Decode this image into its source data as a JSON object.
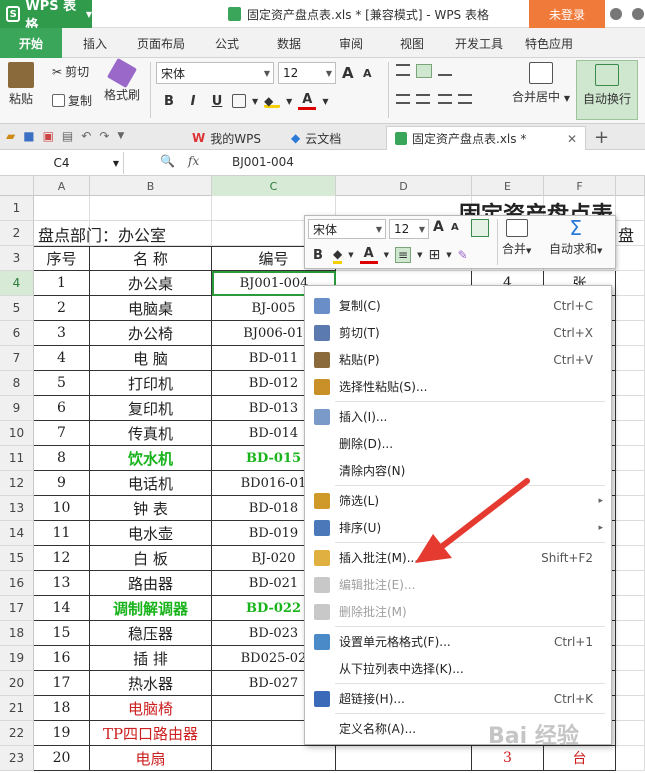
{
  "titlebar": {
    "app_name": "WPS 表格",
    "logo_letter": "S",
    "doc_title": "固定资产盘点表.xls * [兼容模式] - WPS 表格",
    "login": "未登录"
  },
  "menus": [
    "开始",
    "插入",
    "页面布局",
    "公式",
    "数据",
    "审阅",
    "视图",
    "开发工具",
    "特色应用"
  ],
  "ribbon": {
    "cut": "剪切",
    "copy": "复制",
    "paste": "粘贴",
    "format_painter": "格式刷",
    "font_name": "宋体",
    "font_size": "12",
    "bold": "B",
    "italic": "I",
    "underline": "U",
    "merge_center": "合并居中",
    "wrap_text": "自动换行",
    "grow_font": "A",
    "shrink_font": "A"
  },
  "tabs": [
    "我的WPS",
    "云文档",
    "固定资产盘点表.xls *"
  ],
  "formula": {
    "cell_ref": "C4",
    "fx": "fx",
    "content": "BJ001-004"
  },
  "columns": [
    "A",
    "B",
    "C",
    "D",
    "E",
    "F"
  ],
  "row_numbers": [
    "1",
    "2",
    "3",
    "4",
    "5",
    "6",
    "7",
    "8",
    "9",
    "10",
    "11",
    "12",
    "13",
    "14",
    "15",
    "16",
    "17",
    "18",
    "19",
    "20",
    "21",
    "22",
    "23"
  ],
  "sheet": {
    "title": "固定资产盘点表",
    "dept_label": "盘点部门：办公室",
    "right_cut": "盘",
    "headers": [
      "序号",
      "名 称",
      "编号"
    ],
    "rows": [
      {
        "a": "1",
        "b": "办公桌",
        "c": "BJ001-004",
        "e": "4",
        "f": "张",
        "style": ""
      },
      {
        "a": "2",
        "b": "电脑桌",
        "c": "BJ-005",
        "e": "",
        "f": "",
        "style": ""
      },
      {
        "a": "3",
        "b": "办公椅",
        "c": "BJ006-01",
        "e": "",
        "f": "",
        "style": ""
      },
      {
        "a": "4",
        "b": "电  脑",
        "c": "BD-011",
        "e": "",
        "f": "",
        "style": ""
      },
      {
        "a": "5",
        "b": "打印机",
        "c": "BD-012",
        "e": "",
        "f": "",
        "style": ""
      },
      {
        "a": "6",
        "b": "复印机",
        "c": "BD-013",
        "e": "",
        "f": "",
        "style": ""
      },
      {
        "a": "7",
        "b": "传真机",
        "c": "BD-014",
        "e": "",
        "f": "",
        "style": ""
      },
      {
        "a": "8",
        "b": "饮水机",
        "c": "BD-015",
        "e": "",
        "f": "",
        "style": "green"
      },
      {
        "a": "9",
        "b": "电话机",
        "c": "BD016-01",
        "e": "",
        "f": "",
        "style": ""
      },
      {
        "a": "10",
        "b": "钟  表",
        "c": "BD-018",
        "e": "",
        "f": "",
        "style": ""
      },
      {
        "a": "11",
        "b": "电水壶",
        "c": "BD-019",
        "e": "",
        "f": "",
        "style": ""
      },
      {
        "a": "12",
        "b": "白  板",
        "c": "BJ-020",
        "e": "",
        "f": "",
        "style": ""
      },
      {
        "a": "13",
        "b": "路由器",
        "c": "BD-021",
        "e": "",
        "f": "",
        "style": ""
      },
      {
        "a": "14",
        "b": "调制解调器",
        "c": "BD-022",
        "e": "",
        "f": "",
        "style": "green"
      },
      {
        "a": "15",
        "b": "稳压器",
        "c": "BD-023",
        "e": "",
        "f": "",
        "style": ""
      },
      {
        "a": "16",
        "b": "插  排",
        "c": "BD025-02",
        "e": "",
        "f": "",
        "style": ""
      },
      {
        "a": "17",
        "b": "热水器",
        "c": "BD-027",
        "e": "",
        "f": "",
        "style": ""
      },
      {
        "a": "18",
        "b": "电脑椅",
        "c": "",
        "e": "",
        "f": "",
        "style": "red"
      },
      {
        "a": "19",
        "b": "TP四口路由器",
        "c": "",
        "e": "",
        "f": "",
        "style": "red"
      },
      {
        "a": "20",
        "b": "电扇",
        "c": "",
        "e": "3",
        "f": "台",
        "style": "red"
      }
    ]
  },
  "minibar": {
    "font": "宋体",
    "size": "12",
    "merge": "合并",
    "autosum": "自动求和",
    "bold": "B"
  },
  "context_menu": [
    {
      "label": "复制(C)",
      "shortcut": "Ctrl+C",
      "icon": "copy-icon",
      "disabled": false,
      "sub": false
    },
    {
      "label": "剪切(T)",
      "shortcut": "Ctrl+X",
      "icon": "scissors-icon",
      "disabled": false,
      "sub": false
    },
    {
      "label": "粘贴(P)",
      "shortcut": "Ctrl+V",
      "icon": "paste-icon",
      "disabled": false,
      "sub": false
    },
    {
      "label": "选择性粘贴(S)...",
      "shortcut": "",
      "icon": "paste-special-icon",
      "disabled": false,
      "sub": false,
      "sep_after": true
    },
    {
      "label": "插入(I)...",
      "shortcut": "",
      "icon": "insert-icon",
      "disabled": false,
      "sub": false
    },
    {
      "label": "删除(D)...",
      "shortcut": "",
      "icon": "",
      "disabled": false,
      "sub": false
    },
    {
      "label": "清除内容(N)",
      "shortcut": "",
      "icon": "",
      "disabled": false,
      "sub": false,
      "sep_after": true
    },
    {
      "label": "筛选(L)",
      "shortcut": "",
      "icon": "filter-icon",
      "disabled": false,
      "sub": true
    },
    {
      "label": "排序(U)",
      "shortcut": "",
      "icon": "sort-icon",
      "disabled": false,
      "sub": true,
      "sep_after": true
    },
    {
      "label": "插入批注(M)...",
      "shortcut": "Shift+F2",
      "icon": "comment-insert-icon",
      "disabled": false,
      "sub": false
    },
    {
      "label": "编辑批注(E)...",
      "shortcut": "",
      "icon": "comment-edit-icon",
      "disabled": true,
      "sub": false
    },
    {
      "label": "删除批注(M)",
      "shortcut": "",
      "icon": "comment-delete-icon",
      "disabled": true,
      "sub": false,
      "sep_after": true
    },
    {
      "label": "设置单元格格式(F)...",
      "shortcut": "Ctrl+1",
      "icon": "format-cells-icon",
      "disabled": false,
      "sub": false
    },
    {
      "label": "从下拉列表中选择(K)...",
      "shortcut": "",
      "icon": "",
      "disabled": false,
      "sub": false,
      "sep_after": true
    },
    {
      "label": "超链接(H)...",
      "shortcut": "Ctrl+K",
      "icon": "hyperlink-icon",
      "disabled": false,
      "sub": false,
      "sep_after": true
    },
    {
      "label": "定义名称(A)...",
      "shortcut": "",
      "icon": "",
      "disabled": false,
      "sub": false
    }
  ],
  "colors": {
    "wps_green": "#2f9b4b",
    "login_orange": "#f07a3a",
    "arrow_red": "#e53a2f",
    "highlight_green": "#19b41c",
    "item_red": "#cc1f1f"
  },
  "watermark": "Bai 经验"
}
